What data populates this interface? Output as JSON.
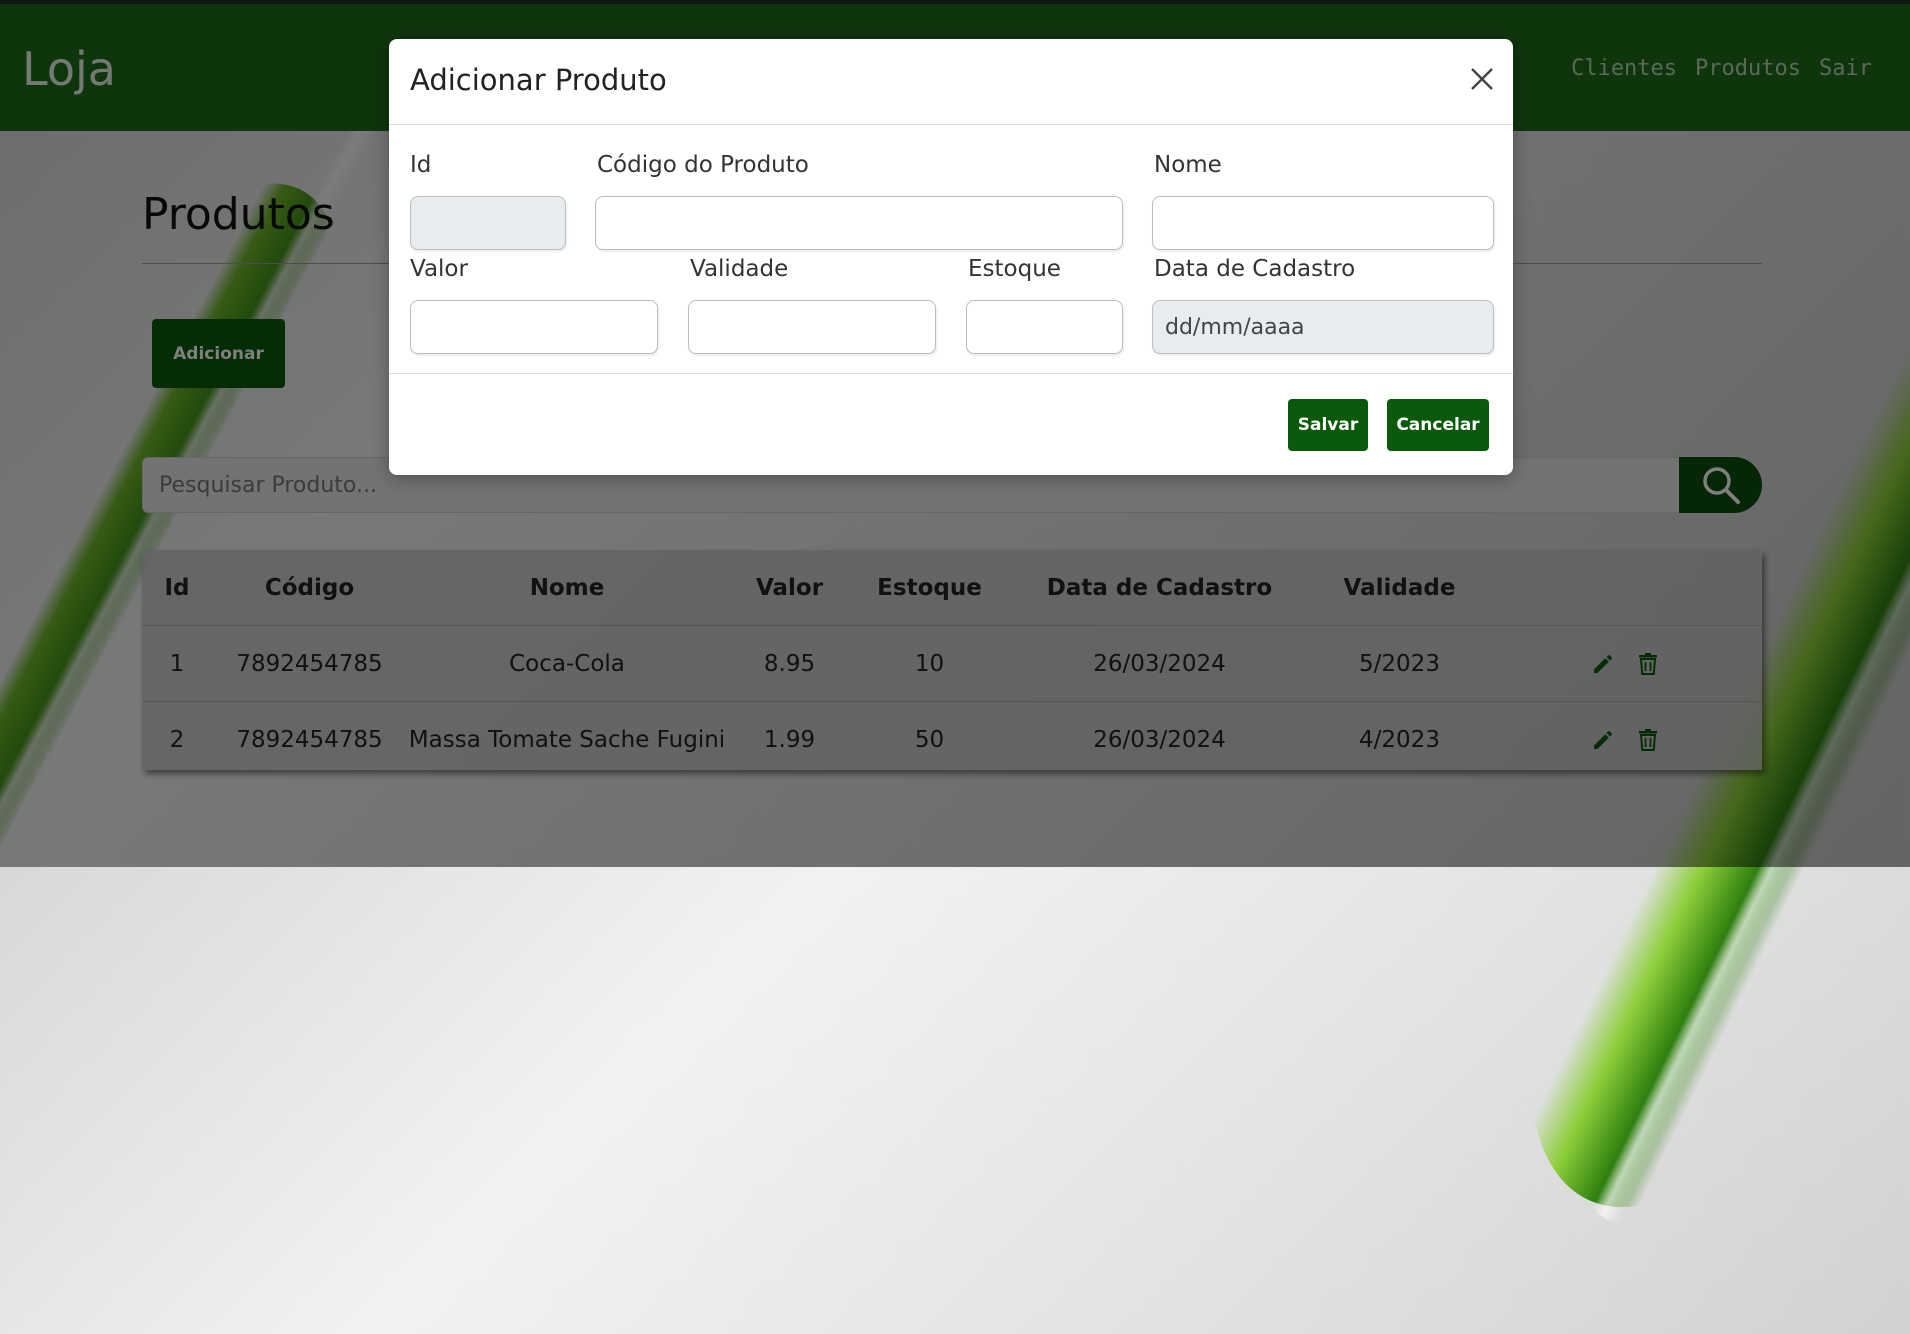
{
  "navbar": {
    "brand": "Loja",
    "links": [
      "Clientes",
      "Produtos",
      "Sair"
    ]
  },
  "page": {
    "title": "Produtos",
    "add_button": "Adicionar",
    "search_placeholder": "Pesquisar Produto..."
  },
  "table": {
    "headers": [
      "Id",
      "Código",
      "Nome",
      "Valor",
      "Estoque",
      "Data de Cadastro",
      "Validade"
    ],
    "rows": [
      {
        "id": "1",
        "codigo": "7892454785",
        "nome": "Coca-Cola",
        "valor": "8.95",
        "estoque": "10",
        "data": "26/03/2024",
        "validade": "5/2023"
      },
      {
        "id": "2",
        "codigo": "7892454785",
        "nome": "Massa Tomate Sache Fugini",
        "valor": "1.99",
        "estoque": "50",
        "data": "26/03/2024",
        "validade": "4/2023"
      }
    ]
  },
  "modal": {
    "title": "Adicionar Produto",
    "labels": {
      "id": "Id",
      "codigo": "Código do Produto",
      "nome": "Nome",
      "valor": "Valor",
      "validade": "Validade",
      "estoque": "Estoque",
      "data_cadastro": "Data de Cadastro"
    },
    "values": {
      "id": "",
      "codigo": "",
      "nome": "",
      "valor": "",
      "validade": "",
      "estoque": "",
      "data_cadastro": "dd/mm/aaaa"
    },
    "save_button": "Salvar",
    "cancel_button": "Cancelar"
  },
  "colors": {
    "brand_green": "#1e6b1a",
    "button_green": "#0b5a0b"
  }
}
